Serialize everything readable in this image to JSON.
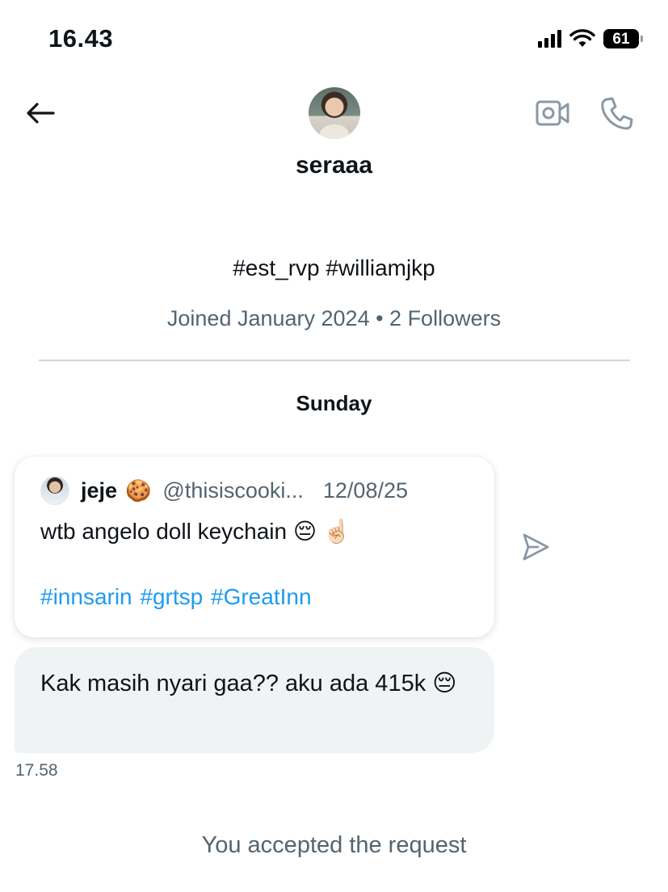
{
  "status_bar": {
    "time": "16.43",
    "battery": "61"
  },
  "header": {
    "name": "seraaa"
  },
  "profile": {
    "bio": "#est_rvp #williamjkp",
    "meta": "Joined January 2024 • 2 Followers"
  },
  "conversation": {
    "day_label": "Sunday",
    "shared_post": {
      "author": "jeje",
      "author_emoji": "🍪",
      "handle": "@thisiscooki...",
      "date": "12/08/25",
      "text": "wtb angelo doll keychain 😔 ☝🏻",
      "hashtags": "#innsarin #grtsp #GreatInn"
    },
    "message": {
      "text": "Kak masih nyari gaa?? aku ada 415k 😔",
      "time": "17.58"
    },
    "system_notice": "You accepted the request"
  },
  "colors": {
    "text_primary": "#0f1419",
    "text_secondary": "#536471",
    "link": "#1d9bf0",
    "bubble_bg": "#eff3f4",
    "divider": "#cfd9de"
  },
  "icons": [
    "back-arrow-icon",
    "video-camera-icon",
    "phone-icon",
    "share-send-icon",
    "signal-icon",
    "wifi-icon",
    "battery-icon"
  ]
}
